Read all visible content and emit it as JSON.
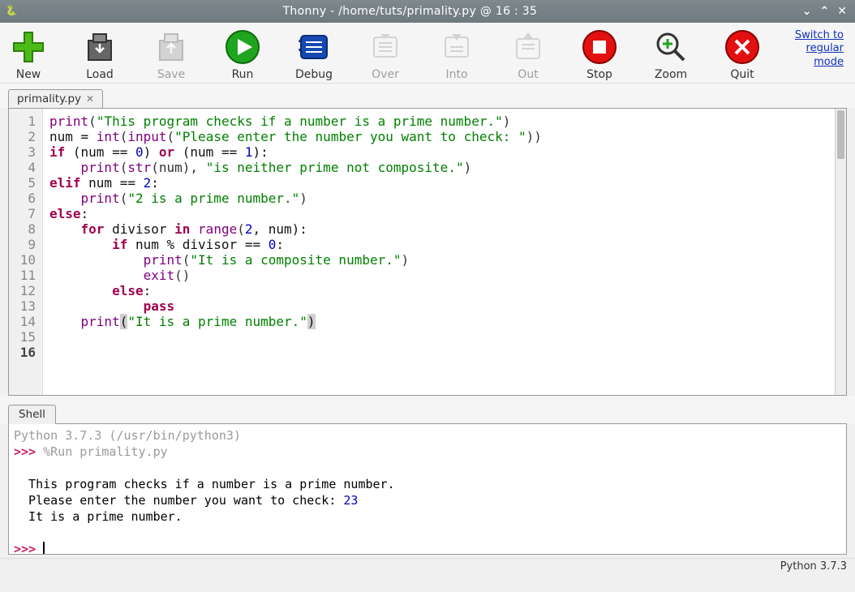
{
  "window": {
    "title": "Thonny  -  /home/tuts/primality.py  @  16 : 35"
  },
  "toolbar": {
    "new": "New",
    "load": "Load",
    "save": "Save",
    "run": "Run",
    "debug": "Debug",
    "over": "Over",
    "into": "Into",
    "out": "Out",
    "stop": "Stop",
    "zoom": "Zoom",
    "quit": "Quit",
    "switch_line1": "Switch to",
    "switch_line2": "regular",
    "switch_line3": "mode"
  },
  "tabs": {
    "file": "primality.py"
  },
  "editor": {
    "current_line": 16,
    "lines": [
      {
        "n": 1,
        "segs": [
          {
            "t": "print",
            "c": "bi"
          },
          {
            "t": "(",
            "c": "op"
          },
          {
            "t": "\"This program checks if a number is a prime number.\"",
            "c": "str"
          },
          {
            "t": ")",
            "c": "op"
          }
        ]
      },
      {
        "n": 2,
        "segs": [
          {
            "t": "num = "
          },
          {
            "t": "int",
            "c": "bi"
          },
          {
            "t": "(",
            "c": "op"
          },
          {
            "t": "input",
            "c": "bi"
          },
          {
            "t": "(",
            "c": "op"
          },
          {
            "t": "\"Please enter the number you want to check: \"",
            "c": "str"
          },
          {
            "t": "))",
            "c": "op"
          }
        ]
      },
      {
        "n": 3,
        "segs": [
          {
            "t": ""
          }
        ]
      },
      {
        "n": 4,
        "segs": [
          {
            "t": "if",
            "c": "kw"
          },
          {
            "t": " (num == "
          },
          {
            "t": "0",
            "c": "num"
          },
          {
            "t": ") "
          },
          {
            "t": "or",
            "c": "kw"
          },
          {
            "t": " (num == "
          },
          {
            "t": "1",
            "c": "num"
          },
          {
            "t": "):"
          }
        ]
      },
      {
        "n": 5,
        "segs": [
          {
            "t": "    "
          },
          {
            "t": "print",
            "c": "bi"
          },
          {
            "t": "(",
            "c": "op"
          },
          {
            "t": "str",
            "c": "bi"
          },
          {
            "t": "(num), ",
            "c": "op"
          },
          {
            "t": "\"is neither prime not composite.\"",
            "c": "str"
          },
          {
            "t": ")",
            "c": "op"
          }
        ]
      },
      {
        "n": 6,
        "segs": [
          {
            "t": "elif",
            "c": "kw"
          },
          {
            "t": " num == "
          },
          {
            "t": "2",
            "c": "num"
          },
          {
            "t": ":"
          }
        ]
      },
      {
        "n": 7,
        "segs": [
          {
            "t": "    "
          },
          {
            "t": "print",
            "c": "bi"
          },
          {
            "t": "(",
            "c": "op"
          },
          {
            "t": "\"2 is a prime number.\"",
            "c": "str"
          },
          {
            "t": ")",
            "c": "op"
          }
        ]
      },
      {
        "n": 8,
        "segs": [
          {
            "t": "else",
            "c": "kw"
          },
          {
            "t": ":"
          }
        ]
      },
      {
        "n": 9,
        "segs": [
          {
            "t": "    "
          },
          {
            "t": "for",
            "c": "kw"
          },
          {
            "t": " divisor "
          },
          {
            "t": "in",
            "c": "kw"
          },
          {
            "t": " "
          },
          {
            "t": "range",
            "c": "bi"
          },
          {
            "t": "(",
            "c": "op"
          },
          {
            "t": "2",
            "c": "num"
          },
          {
            "t": ", num):"
          }
        ]
      },
      {
        "n": 10,
        "segs": [
          {
            "t": "        "
          },
          {
            "t": "if",
            "c": "kw"
          },
          {
            "t": " num % divisor == "
          },
          {
            "t": "0",
            "c": "num"
          },
          {
            "t": ":"
          }
        ]
      },
      {
        "n": 11,
        "segs": [
          {
            "t": "            "
          },
          {
            "t": "print",
            "c": "bi"
          },
          {
            "t": "(",
            "c": "op"
          },
          {
            "t": "\"It is a composite number.\"",
            "c": "str"
          },
          {
            "t": ")",
            "c": "op"
          }
        ]
      },
      {
        "n": 12,
        "segs": [
          {
            "t": "            "
          },
          {
            "t": "exit",
            "c": "bi"
          },
          {
            "t": "()",
            "c": "op"
          }
        ]
      },
      {
        "n": 13,
        "segs": [
          {
            "t": "        "
          },
          {
            "t": "else",
            "c": "kw"
          },
          {
            "t": ":"
          }
        ]
      },
      {
        "n": 14,
        "segs": [
          {
            "t": "            "
          },
          {
            "t": "pass",
            "c": "kw"
          }
        ]
      },
      {
        "n": 15,
        "segs": [
          {
            "t": ""
          }
        ]
      },
      {
        "n": 16,
        "segs": [
          {
            "t": "    "
          },
          {
            "t": "print",
            "c": "bi"
          },
          {
            "t": "(",
            "c": "hiparen"
          },
          {
            "t": "\"It is a prime number.\"",
            "c": "str"
          },
          {
            "t": ")",
            "c": "hiparen"
          }
        ]
      }
    ]
  },
  "shell": {
    "tab_label": "Shell",
    "interpreter": "Python 3.7.3 (/usr/bin/python3)",
    "prompt": ">>>",
    "magic": "%Run primality.py",
    "out1": "  This program checks if a number is a prime number.",
    "out2a": "  Please enter the number you want to check: ",
    "input": "23",
    "out3": "  It is a prime number."
  },
  "status": {
    "python": "Python 3.7.3"
  }
}
